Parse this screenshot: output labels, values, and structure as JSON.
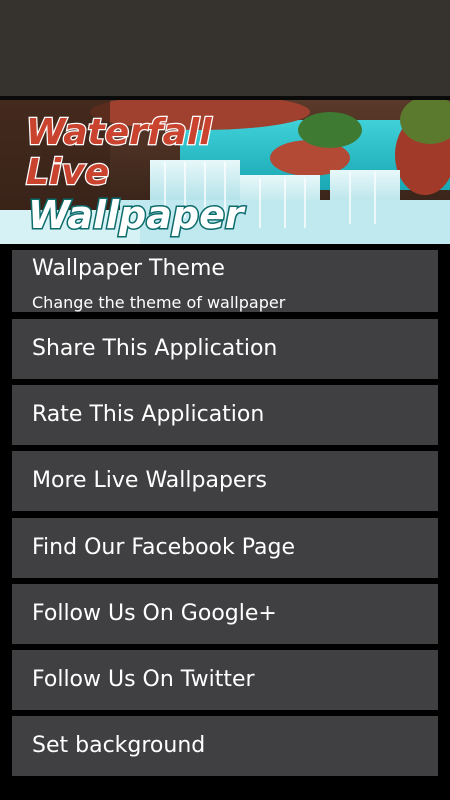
{
  "banner": {
    "title_line1": "Waterfall",
    "title_line2": "Live",
    "title_line3": "Wallpaper"
  },
  "menu": {
    "theme": {
      "title": "Wallpaper Theme",
      "summary": "Change the theme of wallpaper"
    },
    "items": [
      {
        "label": "Share This Application"
      },
      {
        "label": "Rate This Application"
      },
      {
        "label": "More Live Wallpapers"
      },
      {
        "label": "Find Our Facebook Page"
      },
      {
        "label": "Follow Us On Google+"
      },
      {
        "label": "Follow Us On Twitter"
      },
      {
        "label": "Set background"
      }
    ]
  },
  "colors": {
    "statusbar": "#36322d",
    "menu_item_bg": "#404042",
    "page_bg": "#000000",
    "title_red": "#c0392b",
    "title_white": "#ffffff"
  }
}
